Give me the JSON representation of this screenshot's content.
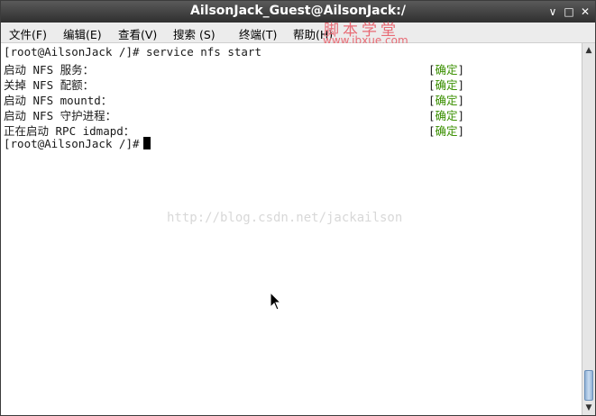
{
  "window": {
    "title": "AilsonJack_Guest@AilsonJack:/",
    "minimize_glyph": "∨",
    "maximize_glyph": "□",
    "close_glyph": "✕"
  },
  "menu": {
    "items": [
      "文件(F)",
      "编辑(E)",
      "查看(V)",
      "搜索 (S)",
      "终端(T)",
      "帮助(H)"
    ]
  },
  "watermark": {
    "cn": "脚本学堂",
    "url": "www.jbxue.com",
    "blog": "http://blog.csdn.net/jackailson"
  },
  "terminal": {
    "prompt_command": "[root@AilsonJack /]# service nfs start",
    "lines": [
      {
        "text": "启动 NFS 服务：",
        "status": "确定"
      },
      {
        "text": "关掉 NFS 配额：",
        "status": "确定"
      },
      {
        "text": "启动 NFS mountd：",
        "status": "确定"
      },
      {
        "text": "启动 NFS 守护进程：",
        "status": "确定"
      },
      {
        "text": "正在启动 RPC idmapd：",
        "status": "确定"
      }
    ],
    "bracket_open": "[",
    "bracket_close": "]",
    "final_prompt": "[root@AilsonJack /]#"
  },
  "colors": {
    "ok": "#3a8f00",
    "watermark": "#e86a74"
  },
  "icons": {
    "mouse": "mouse-pointer-icon",
    "scroll_up": "arrow-up-icon",
    "scroll_down": "arrow-down-icon"
  }
}
